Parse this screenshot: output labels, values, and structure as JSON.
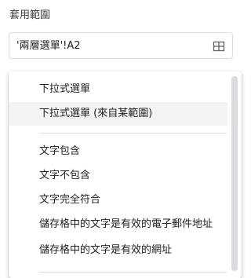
{
  "section": {
    "label": "套用範圍"
  },
  "range_field": {
    "value": "'兩層選單'!A2",
    "icon": "grid-select-range-icon"
  },
  "dropdown": {
    "items": [
      {
        "label": "下拉式選單",
        "highlighted": false
      },
      {
        "label": "下拉式選單 (來自某範圍)",
        "highlighted": true
      },
      {
        "label": "文字包含",
        "highlighted": false
      },
      {
        "label": "文字不包含",
        "highlighted": false
      },
      {
        "label": "文字完全符合",
        "highlighted": false
      },
      {
        "label": "儲存格中的文字是有效的電子郵件地址",
        "highlighted": false
      },
      {
        "label": "儲存格中的文字是有效的網址",
        "highlighted": false
      }
    ]
  },
  "colors": {
    "border": "#dadce0",
    "hover": "#f1f3f4",
    "text": "#202124",
    "scrollbar": "#dadce0"
  }
}
